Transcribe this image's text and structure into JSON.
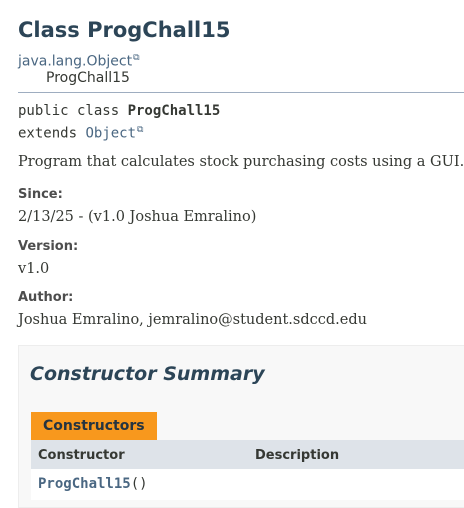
{
  "title": "Class ProgChall15",
  "inheritance": {
    "parent": "java.lang.Object",
    "child": "ProgChall15"
  },
  "signature": {
    "modifiers": "public class ",
    "name": "ProgChall15",
    "extends_kw": "extends ",
    "extends_type": "Object"
  },
  "description": "Program that calculates stock purchasing costs using a GUI.",
  "tags": {
    "since_label": "Since:",
    "since_value": "2/13/25 - (v1.0 Joshua Emralino)",
    "version_label": "Version:",
    "version_value": "v1.0",
    "author_label": "Author:",
    "author_value": "Joshua Emralino, jemralino@student.sdccd.edu"
  },
  "constructor_summary": {
    "heading": "Constructor Summary",
    "tab_label": "Constructors",
    "columns": [
      "Constructor",
      "Description"
    ],
    "rows": [
      {
        "name": "ProgChall15",
        "params": "()",
        "description": ""
      }
    ]
  },
  "icons": {
    "external_link": "external-link-icon"
  },
  "colors": {
    "accent_tab": "#f8981d",
    "link": "#4a6782",
    "heading": "#2c4557",
    "table_header": "#dee3e9"
  }
}
